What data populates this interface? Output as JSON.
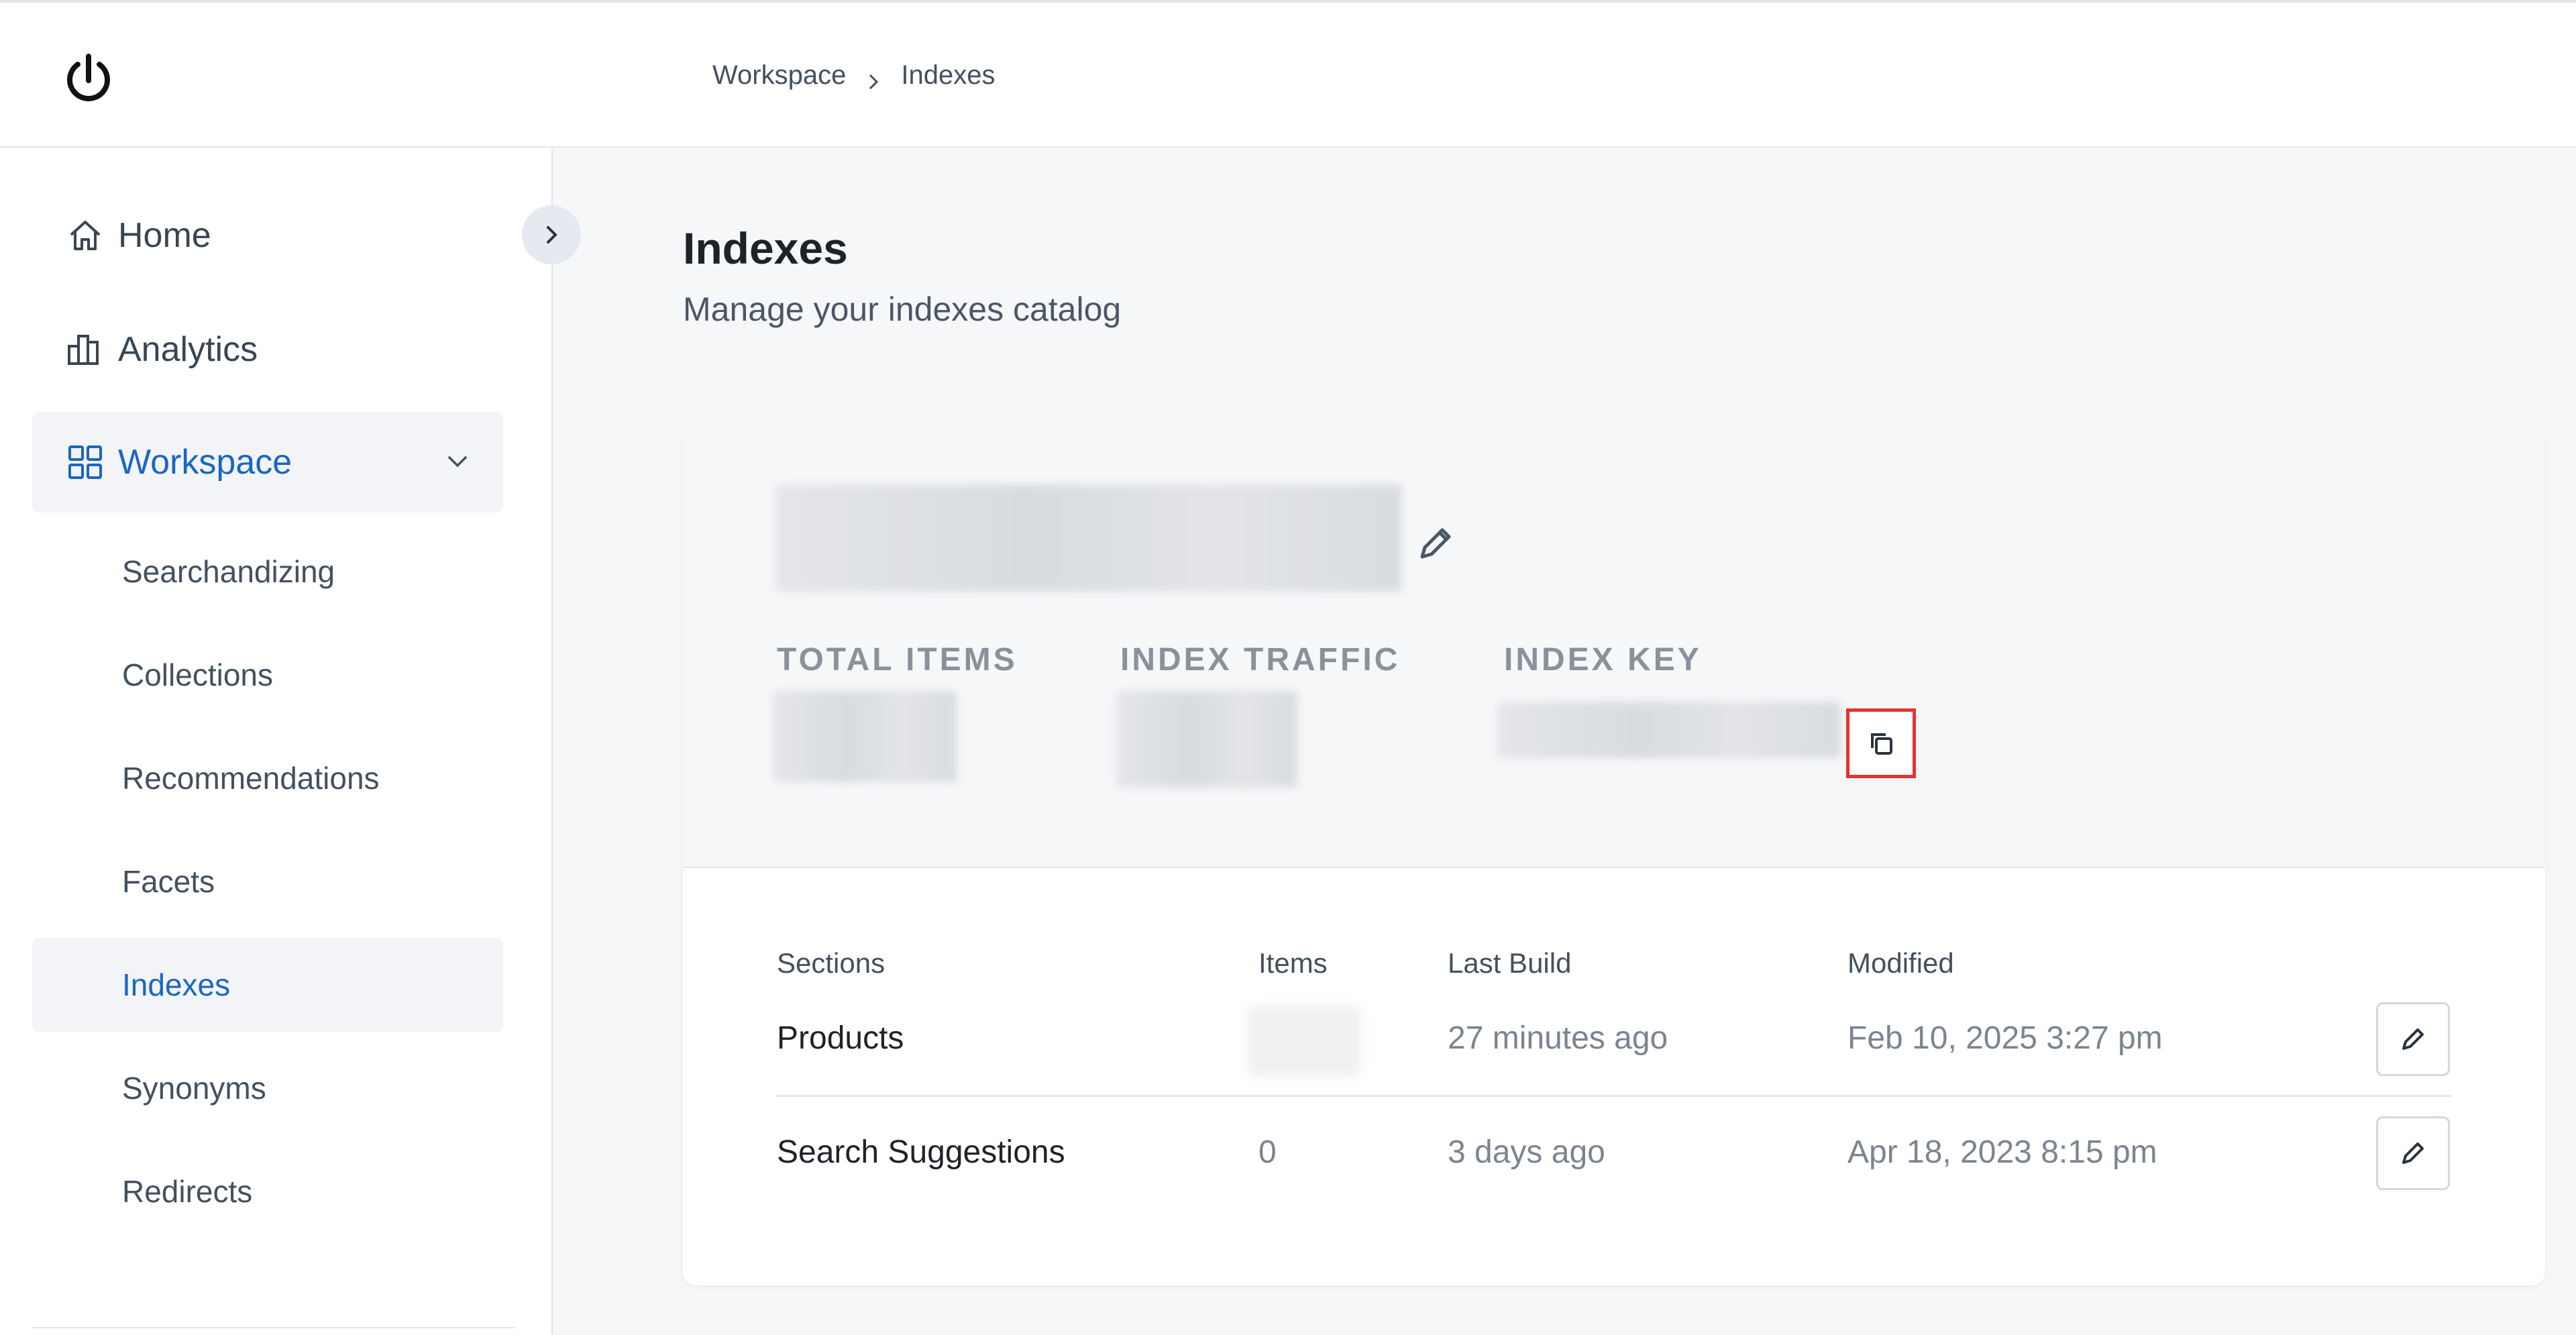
{
  "breadcrumb": {
    "items": [
      "Workspace",
      "Indexes"
    ]
  },
  "sidebar": {
    "items": [
      {
        "label": "Home",
        "icon": "home-icon"
      },
      {
        "label": "Analytics",
        "icon": "analytics-icon"
      },
      {
        "label": "Workspace",
        "icon": "grid-icon",
        "expanded": true
      }
    ],
    "sub_items": [
      {
        "label": "Searchandizing"
      },
      {
        "label": "Collections"
      },
      {
        "label": "Recommendations"
      },
      {
        "label": "Facets"
      },
      {
        "label": "Indexes",
        "active": true
      },
      {
        "label": "Synonyms"
      },
      {
        "label": "Redirects"
      }
    ]
  },
  "page": {
    "title": "Indexes",
    "subtitle": "Manage your indexes catalog"
  },
  "index_card": {
    "stats": {
      "total_items_label": "TOTAL ITEMS",
      "index_traffic_label": "INDEX TRAFFIC",
      "index_key_label": "INDEX KEY"
    },
    "table": {
      "headers": {
        "sections": "Sections",
        "items": "Items",
        "last_build": "Last Build",
        "modified": "Modified"
      },
      "rows": [
        {
          "section": "Products",
          "items": "",
          "last_build": "27 minutes ago",
          "modified": "Feb 10, 2025 3:27 pm"
        },
        {
          "section": "Search Suggestions",
          "items": "0",
          "last_build": "3 days ago",
          "modified": "Apr 18, 2023 8:15 pm"
        }
      ]
    }
  },
  "colors": {
    "accent": "#1a66c2",
    "highlight": "#e23333"
  }
}
